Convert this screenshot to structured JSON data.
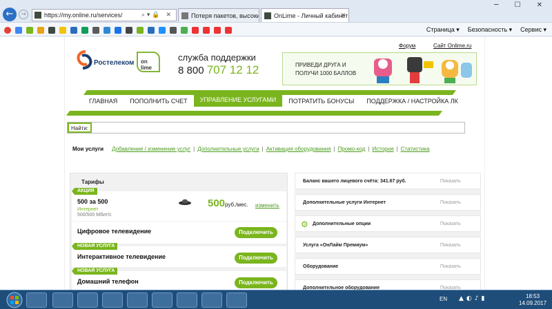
{
  "browser": {
    "url": "https://my.online.ru/services/",
    "tabs": [
      {
        "label": "Потеря пакетов, высокий пи..."
      },
      {
        "label": "OnLime - Личный кабинет"
      }
    ],
    "command_menu": [
      "Страница ▾",
      "Безопасность ▾",
      "Сервис ▾"
    ]
  },
  "site": {
    "logo_text": "Ростелеком",
    "onlime_text": "on lime",
    "support_title": "служба поддержки",
    "phone_prefix": "8 800",
    "phone_number": "707 12 12",
    "top_links": {
      "forum": "Форум",
      "site": "Сайт Onlime.ru"
    },
    "promo": {
      "line1": "ПРИВЕДИ ДРУГА И",
      "line2": "ПОЛУЧИ 1000 БАЛЛОВ"
    },
    "menu": [
      "ГЛАВНАЯ",
      "ПОПОЛНИТЬ СЧЕТ",
      "УПРАВЛЕНИЕ УСЛУГАМИ",
      "ПОТРАТИТЬ БОНУСЫ",
      "ПОДДЕРЖКА / НАСТРОЙКА ЛК"
    ],
    "search_label": "Найти:",
    "subnav": {
      "current": "Мои услуги",
      "items": [
        "Добавление / изменение услуг",
        "Дополнительные услуги",
        "Активация оборудования",
        "Промо-код",
        "История",
        "Статистика"
      ]
    },
    "left": {
      "title": "Тарифы",
      "tariff": {
        "tag": "АКЦИЯ",
        "name": "500 за 500",
        "type": "Интернет",
        "speed": "500/500 Мбит/с",
        "price": "500",
        "unit": "руб./мес.",
        "change": "изменить"
      },
      "services": [
        {
          "tag": "",
          "name": "Цифровое телевидение",
          "button": "Подключить"
        },
        {
          "tag": "НОВАЯ УСЛУГА",
          "name": "Интерактивное телевидение",
          "button": "Подключить"
        },
        {
          "tag": "НОВАЯ УСЛУГА",
          "name": "Домашний телефон",
          "button": "Подключить"
        }
      ]
    },
    "right": {
      "rows": [
        {
          "label": "Баланс вашего лицевого счёта: 341.67 руб.",
          "action": "Показать"
        },
        {
          "label": "Дополнительные услуги Интернет",
          "action": "Показать"
        },
        {
          "label": "Дополнительные опции",
          "action": "Показать"
        },
        {
          "label": "Услуга «ОнЛайм Премиум»",
          "action": "Показать"
        },
        {
          "label": "Оборудование",
          "action": "Показать"
        },
        {
          "label": "Дополнительное оборудование",
          "action": "Показать"
        }
      ]
    }
  },
  "taskbar": {
    "lang": "EN",
    "time": "18:53",
    "date": "14.09.2017"
  },
  "colors": {
    "accent": "#7ab51d",
    "brand_blue": "#1a3d6f"
  }
}
